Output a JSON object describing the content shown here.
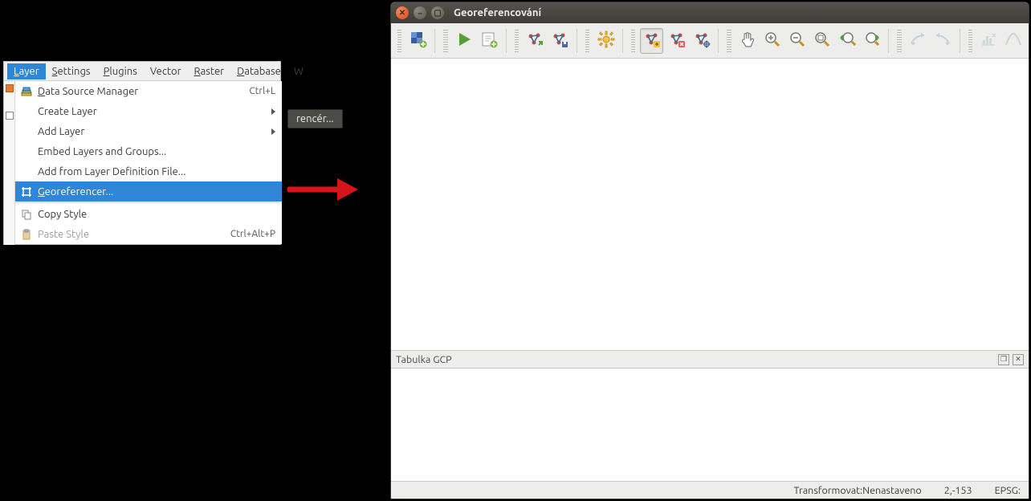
{
  "qgis": {
    "menubar": [
      "Layer",
      "Settings",
      "Plugins",
      "Vector",
      "Raster",
      "Database",
      "W"
    ],
    "menubar_underline_idx": [
      0,
      0,
      0,
      null,
      0,
      0,
      null
    ],
    "menubar_open_index": 0,
    "dropdown": [
      {
        "icon": "stack",
        "label": "Data Source Manager",
        "shortcut": "Ctrl+L",
        "ul": 0
      },
      {
        "label": "Create Layer",
        "submenu": true
      },
      {
        "label": "Add Layer",
        "submenu": true
      },
      {
        "label": "Embed Layers and Groups..."
      },
      {
        "label": "Add from Layer Definition File..."
      },
      {
        "icon": "grid",
        "label": "Georeferencer...",
        "highlight": true,
        "ul": 0
      },
      {
        "sep": true
      },
      {
        "icon": "copy",
        "label": "Copy Style"
      },
      {
        "icon": "paste",
        "label": "Paste Style",
        "shortcut": "Ctrl+Alt+P",
        "disabled": true
      }
    ],
    "tooltip_fragment": "rencér..."
  },
  "georef": {
    "title": "Georeferencování",
    "toolbar": [
      "grip",
      {
        "name": "open-raster-button",
        "icon": "raster-plus"
      },
      "sep",
      "grip",
      {
        "name": "start-button",
        "icon": "play"
      },
      {
        "name": "generate-script-button",
        "icon": "script"
      },
      "sep",
      "grip",
      {
        "name": "load-gcp-button",
        "icon": "gcp-load"
      },
      {
        "name": "save-gcp-button",
        "icon": "gcp-save"
      },
      "sep",
      "grip",
      {
        "name": "transform-settings-button",
        "icon": "gear"
      },
      "sep",
      "grip",
      {
        "name": "add-point-button",
        "icon": "point-add",
        "active": true
      },
      {
        "name": "delete-point-button",
        "icon": "point-del"
      },
      {
        "name": "move-point-button",
        "icon": "point-move"
      },
      "sep",
      "grip",
      {
        "name": "pan-button",
        "icon": "hand"
      },
      {
        "name": "zoom-in-button",
        "icon": "zoom-in"
      },
      {
        "name": "zoom-out-button",
        "icon": "zoom-out"
      },
      {
        "name": "zoom-layer-button",
        "icon": "zoom-layer"
      },
      {
        "name": "zoom-last-button",
        "icon": "zoom-last"
      },
      {
        "name": "zoom-next-button",
        "icon": "zoom-next"
      },
      "sep",
      "grip",
      {
        "name": "link-georef-button",
        "icon": "link1",
        "disabled": true
      },
      {
        "name": "link-qgis-button",
        "icon": "link2",
        "disabled": true
      },
      "sep",
      "grip",
      {
        "name": "full-histogram-button",
        "icon": "hist1",
        "disabled": true
      },
      {
        "name": "local-histogram-button",
        "icon": "hist2",
        "disabled": true
      }
    ],
    "gcp_panel_title": "Tabulka GCP",
    "status": {
      "transform_label": "Transformovat:",
      "transform_value": "Nenastaveno",
      "coords": "2,-153",
      "epsg_label": "EPSG:"
    }
  }
}
